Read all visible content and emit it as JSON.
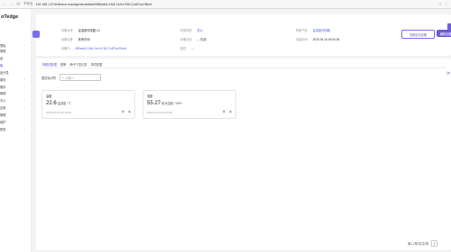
{
  "browser": {
    "back": "←",
    "forward": "→",
    "reload": "⟳",
    "insecure": "不安全",
    "url": "192.168.1.97/#/device-management/detail/6ff5eab5-15df-11ef-b765-21d57ac78ee4"
  },
  "sidebar": {
    "logo": "oTedge",
    "items": [
      {
        "label": "表板",
        "chev": "⌄"
      },
      {
        "label": "管理",
        "chev": "⌄"
      },
      {
        "label": "品",
        "chev": ""
      },
      {
        "label": "备",
        "chev": "",
        "active": true
      },
      {
        "label": "品分类",
        "chev": ""
      },
      {
        "label": "服务",
        "chev": "⌄"
      },
      {
        "label": "服务",
        "chev": "⌄"
      },
      {
        "label": "管理",
        "chev": "⌄"
      },
      {
        "label": "中心",
        "chev": "⌄"
      },
      {
        "label": "应用",
        "chev": "⌄"
      },
      {
        "label": "管理",
        "chev": "⌄"
      },
      {
        "label": "维护",
        "chev": ""
      },
      {
        "label": "配置",
        "chev": "⌄"
      }
    ]
  },
  "device": {
    "name_label": "设备名称",
    "name": "温湿度传感器_01",
    "product_label": "所属产品",
    "product": "温湿度传感器",
    "gateway_label": "所属网关",
    "gateway": "默认",
    "location_label": "设备位置",
    "location": "库房东侧",
    "status_label": "设备状态",
    "status": "在线",
    "created_label": "创建时间",
    "created": "2025-04-18 09:40:08",
    "id_label": "设备ID",
    "id": "6ff5eab5-15df-11ef-b765-21d57ac78ee4",
    "desc_label": "描述",
    "desc": "--",
    "btn_outline": "重新启动设备",
    "btn_primary": "编辑设备"
  },
  "tabs": [
    "物模型数据",
    "报警",
    "命令下发记录",
    "事件数据"
  ],
  "filter": {
    "label": "属性标识符",
    "placeholder": "请输入"
  },
  "metrics": [
    {
      "name": "温度",
      "value": "22.6",
      "unit": "温湿值 / ℃",
      "time": "2025-04-18 09:40:08"
    },
    {
      "name": "湿度",
      "value": "55.27",
      "unit": "相对湿度 / %RH",
      "time": "2025-04-18 09:40:08"
    }
  ],
  "pager": {
    "text": "第1-2条/总共2条",
    "page": "1"
  }
}
